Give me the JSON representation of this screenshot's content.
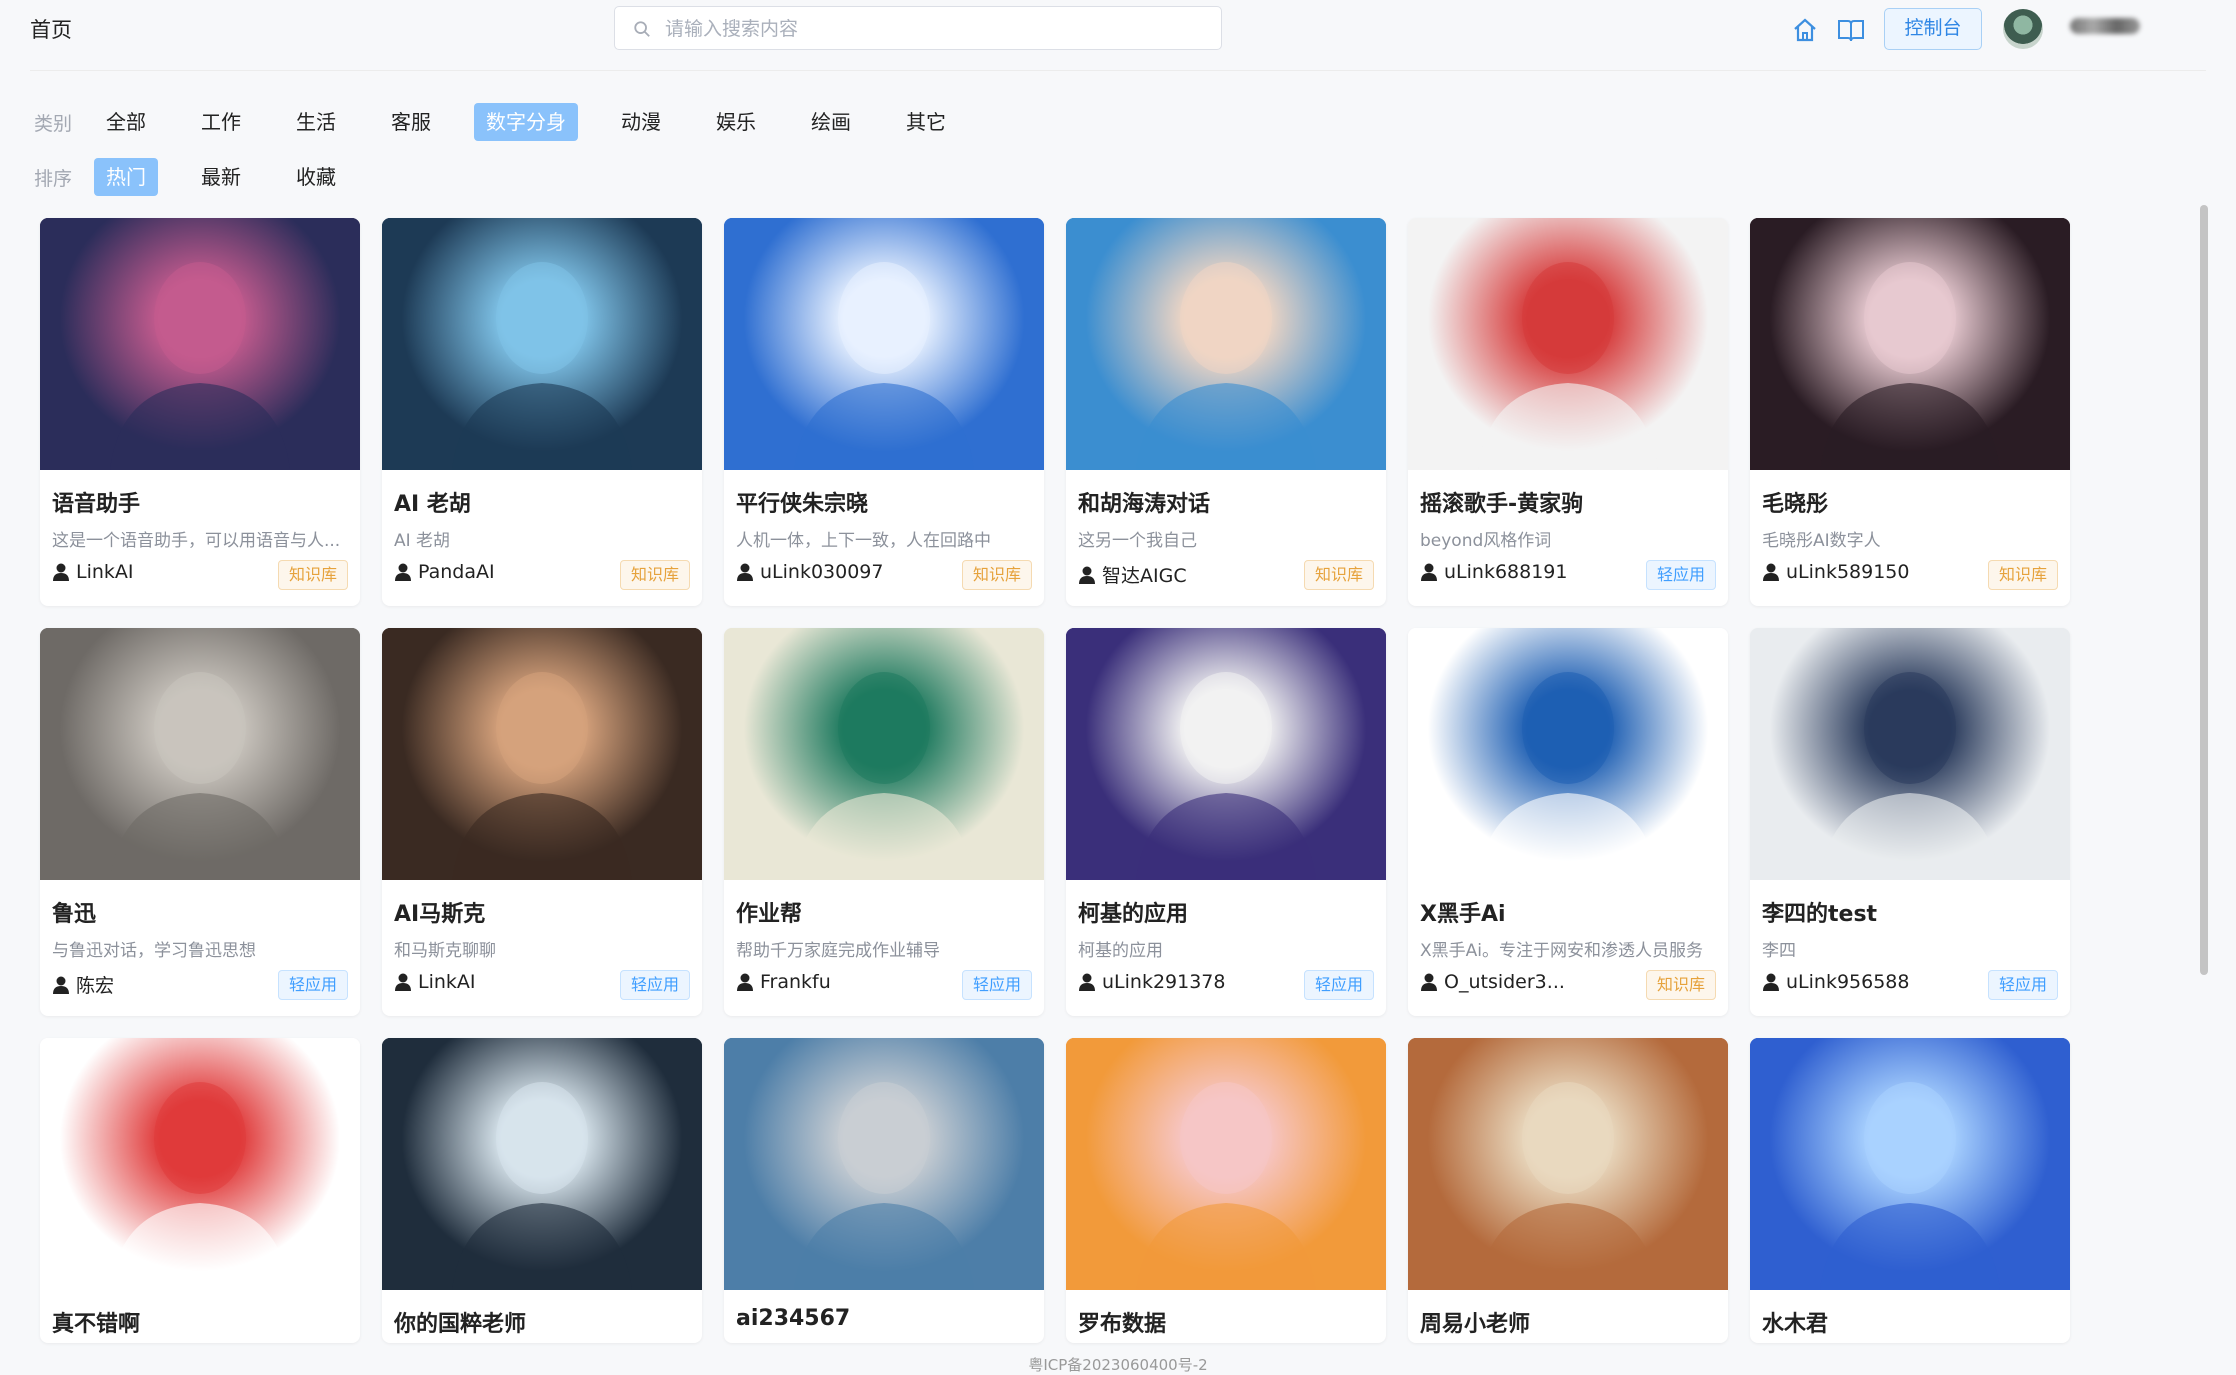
{
  "breadcrumb": "首页",
  "search": {
    "placeholder": "请输入搜索内容"
  },
  "header": {
    "console_label": "控制台"
  },
  "filters": {
    "category_label": "类别",
    "categories": [
      "全部",
      "工作",
      "生活",
      "客服",
      "数字分身",
      "动漫",
      "娱乐",
      "绘画",
      "其它"
    ],
    "category_active": "数字分身",
    "sort_label": "排序",
    "sorts": [
      "热门",
      "最新",
      "收藏"
    ],
    "sort_active": "热门"
  },
  "cards": [
    {
      "title": "语音助手",
      "desc": "这是一个语音助手，可以用语音与人...",
      "author": "LinkAI",
      "badge": "知识库",
      "badge_type": "kb",
      "thumb": "man-headphones-portrait",
      "colors": [
        "#2b2d5a",
        "#c45b8e"
      ]
    },
    {
      "title": "AI 老胡",
      "desc": "AI 老胡",
      "author": "PandaAI",
      "badge": "知识库",
      "badge_type": "kb",
      "thumb": "futuristic-data-hologram",
      "colors": [
        "#1d3a55",
        "#7fc3e8"
      ]
    },
    {
      "title": "平行侠朱宗晓",
      "desc": "人机一体，上下一致，人在回路中",
      "author": "uLink030097",
      "badge": "知识库",
      "badge_type": "kb",
      "thumb": "caricature-man-flag",
      "colors": [
        "#2f6fd1",
        "#e8f1ff"
      ]
    },
    {
      "title": "和胡海涛对话",
      "desc": "这另一个我自己",
      "author": "智达AIGC",
      "badge": "知识库",
      "badge_type": "kb",
      "thumb": "young-man-portrait",
      "colors": [
        "#3b8ed0",
        "#f0d6c4"
      ]
    },
    {
      "title": "摇滚歌手-黄家驹",
      "desc": "beyond风格作词",
      "author": "uLink688191",
      "badge": "轻应用",
      "badge_type": "light",
      "thumb": "rock-singer-red-jacket",
      "colors": [
        "#f3f3f3",
        "#d63a3a"
      ]
    },
    {
      "title": "毛晓彤",
      "desc": "毛晓彤AI数字人",
      "author": "uLink589150",
      "badge": "知识库",
      "badge_type": "kb",
      "thumb": "woman-portrait",
      "colors": [
        "#2a1c24",
        "#e7c9d0"
      ]
    },
    {
      "title": "鲁迅",
      "desc": "与鲁迅对话，学习鲁迅思想",
      "author": "陈宏",
      "badge": "轻应用",
      "badge_type": "light",
      "thumb": "vintage-man-photo",
      "colors": [
        "#6e6a66",
        "#c9c4bd"
      ]
    },
    {
      "title": "AI马斯克",
      "desc": "和马斯克聊聊",
      "author": "LinkAI",
      "badge": "轻应用",
      "badge_type": "light",
      "thumb": "musk-portrait",
      "colors": [
        "#3a2a22",
        "#d6a27c"
      ]
    },
    {
      "title": "作业帮",
      "desc": "帮助千万家庭完成作业辅导",
      "author": "Frankfu",
      "badge": "轻应用",
      "badge_type": "light",
      "thumb": "green-character-logo",
      "colors": [
        "#e9e7d6",
        "#1e7a5f"
      ]
    },
    {
      "title": "柯基的应用",
      "desc": "柯基的应用",
      "author": "uLink291378",
      "badge": "轻应用",
      "badge_type": "light",
      "thumb": "doraemon-mosaic",
      "colors": [
        "#3a2f7a",
        "#f2f2f2"
      ]
    },
    {
      "title": "X黑手Ai",
      "desc": "X黑手Ai。专注于网安和渗透人员服务",
      "author": "O_utsider3...",
      "badge": "知识库",
      "badge_type": "kb",
      "thumb": "x-logo-emblem",
      "colors": [
        "#ffffff",
        "#1e5fb3"
      ]
    },
    {
      "title": "李四的test",
      "desc": "李四",
      "author": "uLink956588",
      "badge": "轻应用",
      "badge_type": "light",
      "thumb": "businessman-portrait",
      "colors": [
        "#e9ecef",
        "#2a3b5c"
      ]
    },
    {
      "title": "真不错啊",
      "desc": "",
      "author": "",
      "badge": "",
      "badge_type": "",
      "thumb": "slide-diagram",
      "colors": [
        "#ffffff",
        "#e03b3b"
      ]
    },
    {
      "title": "你的国粹老师",
      "desc": "",
      "author": "",
      "badge": "",
      "badge_type": "",
      "thumb": "anime-girl-city",
      "colors": [
        "#1f2d3c",
        "#d7e4ec"
      ]
    },
    {
      "title": "ai234567",
      "desc": "",
      "author": "",
      "badge": "",
      "badge_type": "",
      "thumb": "robot-thumbs-up",
      "colors": [
        "#4d7ea8",
        "#c9ced3"
      ]
    },
    {
      "title": "罗布数据",
      "desc": "",
      "author": "",
      "badge": "",
      "badge_type": "",
      "thumb": "chopper-cartoon",
      "colors": [
        "#f29a3a",
        "#f6c6c6"
      ]
    },
    {
      "title": "周易小老师",
      "desc": "",
      "author": "",
      "badge": "",
      "badge_type": "",
      "thumb": "chinese-landscape",
      "colors": [
        "#b46a3c",
        "#e9d9bf"
      ]
    },
    {
      "title": "水木君",
      "desc": "",
      "author": "",
      "badge": "",
      "badge_type": "",
      "thumb": "glowing-cube",
      "colors": [
        "#2f5fd0",
        "#a9d2ff"
      ]
    }
  ],
  "footer": "粤ICP备2023060400号-2",
  "icons": [
    "search-icon",
    "home-icon",
    "book-icon",
    "user-icon"
  ]
}
